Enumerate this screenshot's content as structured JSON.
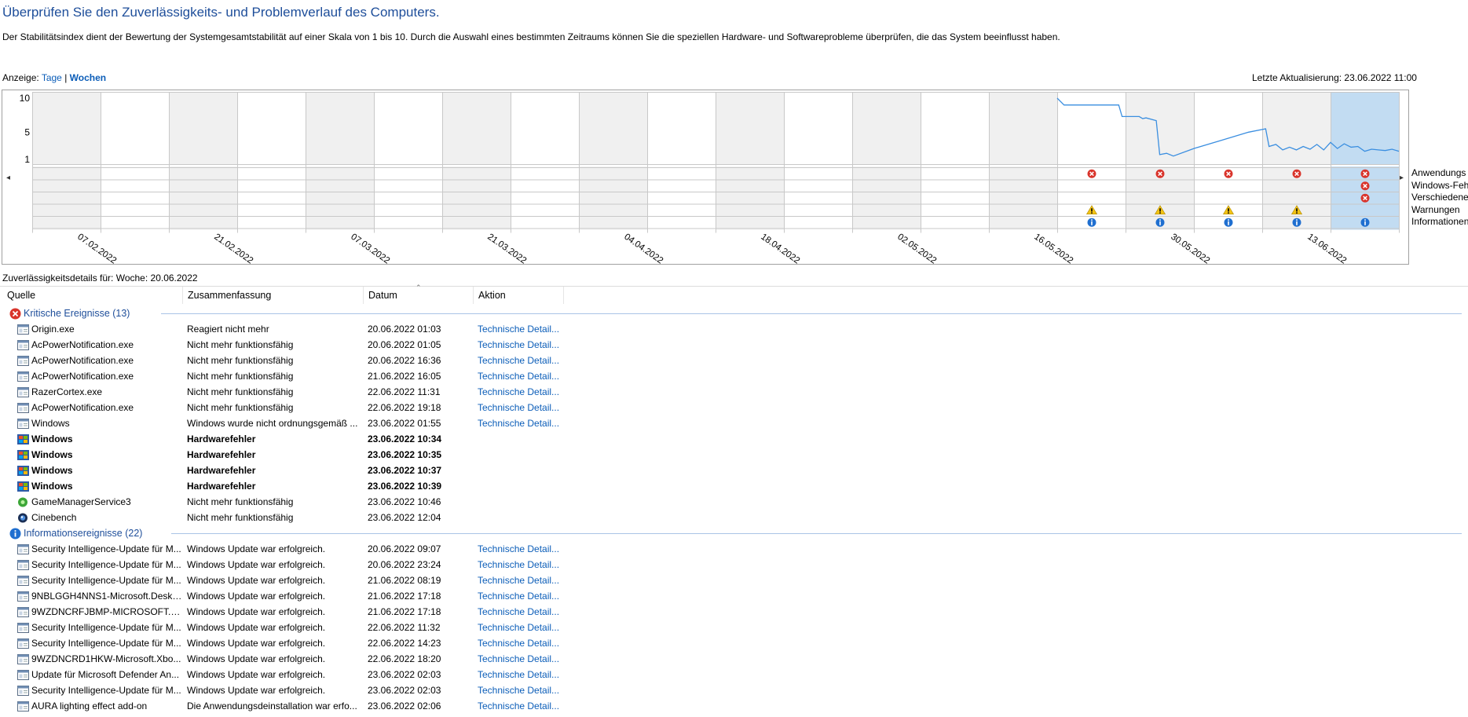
{
  "header": {
    "title": "Überprüfen Sie den Zuverlässigkeits- und Problemverlauf des Computers.",
    "description": "Der Stabilitätsindex dient der Bewertung der Systemgesamtstabilität auf einer Skala von 1 bis 10. Durch die Auswahl eines bestimmten Zeitraums können Sie die speziellen Hardware- und Softwareprobleme überprüfen, die das System beeinflusst haben.",
    "view_label": "Anzeige:",
    "view_days": "Tage",
    "view_separator": "|",
    "view_weeks": "Wochen",
    "last_update": "Letzte Aktualisierung: 23.06.2022 11:00"
  },
  "chart_data": {
    "type": "line",
    "title": "",
    "y_ticks": [
      "10",
      "5",
      "1"
    ],
    "ylim": [
      1,
      10
    ],
    "week_labels": [
      "07.02.2022",
      "21.02.2022",
      "07.03.2022",
      "21.03.2022",
      "04.04.2022",
      "18.04.2022",
      "02.05.2022",
      "16.05.2022",
      "30.05.2022",
      "13.06.2022"
    ],
    "week_count": 20,
    "selected_week_index": 19,
    "stability_index": [
      {
        "x": 15.0,
        "y": 10.0
      },
      {
        "x": 15.1,
        "y": 9.0
      },
      {
        "x": 15.9,
        "y": 9.0
      },
      {
        "x": 15.95,
        "y": 7.3
      },
      {
        "x": 16.2,
        "y": 7.3
      },
      {
        "x": 16.25,
        "y": 7.0
      },
      {
        "x": 16.3,
        "y": 7.1
      },
      {
        "x": 16.45,
        "y": 6.7
      },
      {
        "x": 16.5,
        "y": 1.7
      },
      {
        "x": 16.6,
        "y": 1.9
      },
      {
        "x": 16.7,
        "y": 1.5
      },
      {
        "x": 17.0,
        "y": 2.6
      },
      {
        "x": 17.4,
        "y": 3.8
      },
      {
        "x": 17.8,
        "y": 5.0
      },
      {
        "x": 18.05,
        "y": 5.5
      },
      {
        "x": 18.1,
        "y": 2.9
      },
      {
        "x": 18.2,
        "y": 3.2
      },
      {
        "x": 18.3,
        "y": 2.4
      },
      {
        "x": 18.4,
        "y": 2.8
      },
      {
        "x": 18.5,
        "y": 2.4
      },
      {
        "x": 18.6,
        "y": 2.9
      },
      {
        "x": 18.7,
        "y": 2.5
      },
      {
        "x": 18.8,
        "y": 3.2
      },
      {
        "x": 18.9,
        "y": 2.4
      },
      {
        "x": 19.0,
        "y": 3.5
      },
      {
        "x": 19.1,
        "y": 2.6
      },
      {
        "x": 19.2,
        "y": 3.3
      },
      {
        "x": 19.3,
        "y": 2.8
      },
      {
        "x": 19.4,
        "y": 2.9
      },
      {
        "x": 19.5,
        "y": 2.2
      },
      {
        "x": 19.6,
        "y": 2.5
      },
      {
        "x": 19.7,
        "y": 2.4
      },
      {
        "x": 19.8,
        "y": 2.3
      },
      {
        "x": 19.9,
        "y": 2.5
      },
      {
        "x": 20.0,
        "y": 2.2
      }
    ],
    "event_rows": [
      "Anwendungsfehler",
      "Windows-Fehler",
      "Verschiedene Fehler",
      "Warnungen",
      "Informationen"
    ],
    "event_rows_visible": [
      "Anwendungs",
      "Windows-Feh",
      "Verschiedene",
      "Warnungen",
      "Informationen"
    ],
    "events": [
      {
        "week": 15,
        "row": 0,
        "kind": "error"
      },
      {
        "week": 16,
        "row": 0,
        "kind": "error"
      },
      {
        "week": 17,
        "row": 0,
        "kind": "error"
      },
      {
        "week": 18,
        "row": 0,
        "kind": "error"
      },
      {
        "week": 19,
        "row": 0,
        "kind": "error"
      },
      {
        "week": 19,
        "row": 1,
        "kind": "error"
      },
      {
        "week": 19,
        "row": 2,
        "kind": "error"
      },
      {
        "week": 15,
        "row": 3,
        "kind": "warning"
      },
      {
        "week": 16,
        "row": 3,
        "kind": "warning"
      },
      {
        "week": 17,
        "row": 3,
        "kind": "warning"
      },
      {
        "week": 18,
        "row": 3,
        "kind": "warning"
      },
      {
        "week": 15,
        "row": 4,
        "kind": "info"
      },
      {
        "week": 16,
        "row": 4,
        "kind": "info"
      },
      {
        "week": 17,
        "row": 4,
        "kind": "info"
      },
      {
        "week": 18,
        "row": 4,
        "kind": "info"
      },
      {
        "week": 19,
        "row": 4,
        "kind": "info"
      }
    ],
    "colors": {
      "line": "#3a8ee0",
      "selected": "#c2dcf2",
      "shade": "#f0f0f0",
      "error": "#d9342b",
      "warning": "#f2c314",
      "info": "#1f6fd0"
    }
  },
  "details": {
    "title": "Zuverlässigkeitsdetails für: Woche: 20.06.2022",
    "columns": [
      "Quelle",
      "Zusammenfassung",
      "Datum",
      "Aktion"
    ],
    "groups": [
      {
        "label": "Kritische Ereignisse (13)",
        "icon": "error-icon",
        "rows": [
          {
            "icon": "app-icon",
            "source": "Origin.exe",
            "summary": "Reagiert nicht mehr",
            "date": "20.06.2022 01:03",
            "action": "Technische Detail...",
            "bold": false
          },
          {
            "icon": "app-icon",
            "source": "AcPowerNotification.exe",
            "summary": "Nicht mehr funktionsfähig",
            "date": "20.06.2022 01:05",
            "action": "Technische Detail...",
            "bold": false
          },
          {
            "icon": "app-icon",
            "source": "AcPowerNotification.exe",
            "summary": "Nicht mehr funktionsfähig",
            "date": "20.06.2022 16:36",
            "action": "Technische Detail...",
            "bold": false
          },
          {
            "icon": "app-icon",
            "source": "AcPowerNotification.exe",
            "summary": "Nicht mehr funktionsfähig",
            "date": "21.06.2022 16:05",
            "action": "Technische Detail...",
            "bold": false
          },
          {
            "icon": "app-icon",
            "source": "RazerCortex.exe",
            "summary": "Nicht mehr funktionsfähig",
            "date": "22.06.2022 11:31",
            "action": "Technische Detail...",
            "bold": false
          },
          {
            "icon": "app-icon",
            "source": "AcPowerNotification.exe",
            "summary": "Nicht mehr funktionsfähig",
            "date": "22.06.2022 19:18",
            "action": "Technische Detail...",
            "bold": false
          },
          {
            "icon": "app-icon",
            "source": "Windows",
            "summary": "Windows wurde nicht ordnungsgemäß ...",
            "date": "23.06.2022 01:55",
            "action": "Technische Detail...",
            "bold": false
          },
          {
            "icon": "windows-hardware-icon",
            "source": "Windows",
            "summary": "Hardwarefehler",
            "date": "23.06.2022 10:34",
            "action": "",
            "bold": true
          },
          {
            "icon": "windows-hardware-icon",
            "source": "Windows",
            "summary": "Hardwarefehler",
            "date": "23.06.2022 10:35",
            "action": "",
            "bold": true
          },
          {
            "icon": "windows-hardware-icon",
            "source": "Windows",
            "summary": "Hardwarefehler",
            "date": "23.06.2022 10:37",
            "action": "",
            "bold": true
          },
          {
            "icon": "windows-hardware-icon",
            "source": "Windows",
            "summary": "Hardwarefehler",
            "date": "23.06.2022 10:39",
            "action": "",
            "bold": true
          },
          {
            "icon": "game-manager-icon",
            "source": "GameManagerService3",
            "summary": "Nicht mehr funktionsfähig",
            "date": "23.06.2022 10:46",
            "action": "",
            "bold": false
          },
          {
            "icon": "cinebench-icon",
            "source": "Cinebench",
            "summary": "Nicht mehr funktionsfähig",
            "date": "23.06.2022 12:04",
            "action": "",
            "bold": false
          }
        ]
      },
      {
        "label": "Informationsereignisse (22)",
        "icon": "info-icon",
        "rows": [
          {
            "icon": "app-icon",
            "source": "Security Intelligence-Update für M...",
            "summary": "Windows Update war erfolgreich.",
            "date": "20.06.2022 09:07",
            "action": "Technische Detail...",
            "bold": false
          },
          {
            "icon": "app-icon",
            "source": "Security Intelligence-Update für M...",
            "summary": "Windows Update war erfolgreich.",
            "date": "20.06.2022 23:24",
            "action": "Technische Detail...",
            "bold": false
          },
          {
            "icon": "app-icon",
            "source": "Security Intelligence-Update für M...",
            "summary": "Windows Update war erfolgreich.",
            "date": "21.06.2022 08:19",
            "action": "Technische Detail...",
            "bold": false
          },
          {
            "icon": "app-icon",
            "source": "9NBLGGH4NNS1-Microsoft.Deskt...",
            "summary": "Windows Update war erfolgreich.",
            "date": "21.06.2022 17:18",
            "action": "Technische Detail...",
            "bold": false
          },
          {
            "icon": "app-icon",
            "source": "9WZDNCRFJBMP-MICROSOFT.WI...",
            "summary": "Windows Update war erfolgreich.",
            "date": "21.06.2022 17:18",
            "action": "Technische Detail...",
            "bold": false
          },
          {
            "icon": "app-icon",
            "source": "Security Intelligence-Update für M...",
            "summary": "Windows Update war erfolgreich.",
            "date": "22.06.2022 11:32",
            "action": "Technische Detail...",
            "bold": false
          },
          {
            "icon": "app-icon",
            "source": "Security Intelligence-Update für M...",
            "summary": "Windows Update war erfolgreich.",
            "date": "22.06.2022 14:23",
            "action": "Technische Detail...",
            "bold": false
          },
          {
            "icon": "app-icon",
            "source": "9WZDNCRD1HKW-Microsoft.Xbo...",
            "summary": "Windows Update war erfolgreich.",
            "date": "22.06.2022 18:20",
            "action": "Technische Detail...",
            "bold": false
          },
          {
            "icon": "app-icon",
            "source": "Update für Microsoft Defender An...",
            "summary": "Windows Update war erfolgreich.",
            "date": "23.06.2022 02:03",
            "action": "Technische Detail...",
            "bold": false
          },
          {
            "icon": "app-icon",
            "source": "Security Intelligence-Update für M...",
            "summary": "Windows Update war erfolgreich.",
            "date": "23.06.2022 02:03",
            "action": "Technische Detail...",
            "bold": false
          },
          {
            "icon": "app-icon",
            "source": "AURA lighting effect add-on",
            "summary": "Die Anwendungsdeinstallation war erfo...",
            "date": "23.06.2022 02:06",
            "action": "Technische Detail...",
            "bold": false
          }
        ]
      }
    ]
  }
}
